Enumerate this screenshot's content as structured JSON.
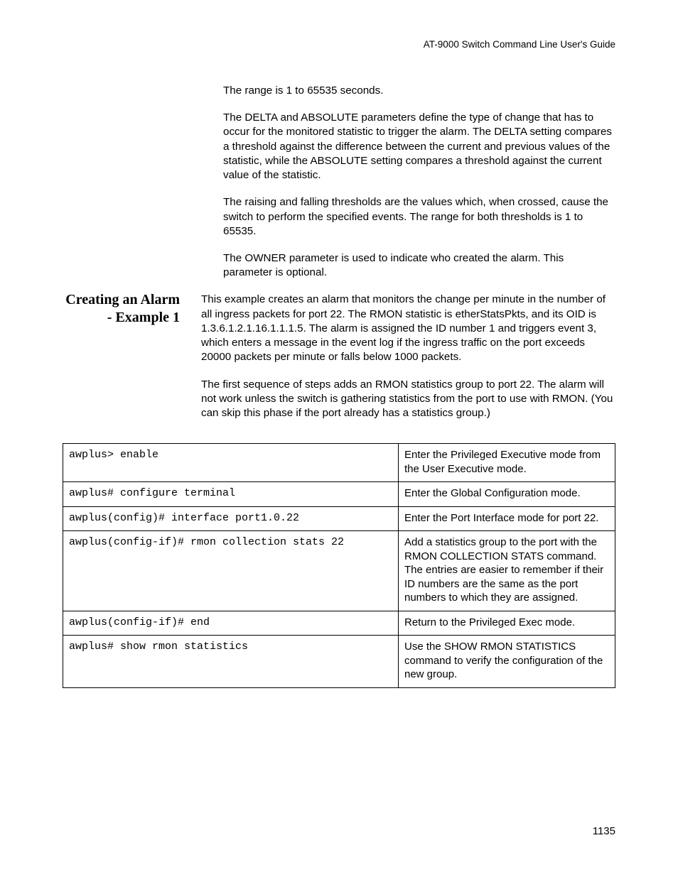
{
  "header": {
    "title": "AT-9000 Switch Command Line User's Guide"
  },
  "intro": {
    "p1": "The range is 1 to 65535 seconds.",
    "p2": "The DELTA and ABSOLUTE parameters define the type of change that has to occur for the monitored statistic to trigger the alarm. The DELTA setting compares a threshold against the difference between the current and previous values of the statistic, while the ABSOLUTE setting compares a threshold against the current value of the statistic.",
    "p3": "The raising and falling thresholds are the values which, when crossed, cause the switch to perform the specified events. The range for both thresholds is 1 to 65535.",
    "p4": "The OWNER parameter is used to indicate who created the alarm. This parameter is optional."
  },
  "section": {
    "heading": "Creating an Alarm - Example 1",
    "p1": "This example creates an alarm that monitors the change per minute in the number of all ingress packets for port 22. The RMON statistic is etherStatsPkts, and its OID is 1.3.6.1.2.1.16.1.1.1.5. The alarm is assigned the ID number 1 and triggers event 3, which enters a message in the event log if the ingress traffic on the port exceeds 20000 packets per minute or falls below 1000 packets.",
    "p2": "The first sequence of steps adds an RMON statistics group to port 22. The alarm will not work unless the switch is gathering statistics from the port to use with RMON. (You can skip this phase if the port already has a statistics group.)"
  },
  "table": {
    "rows": [
      {
        "command": "awplus> enable",
        "description": "Enter the Privileged Executive mode from the User Executive mode."
      },
      {
        "command": "awplus# configure terminal",
        "description": "Enter the Global Configuration mode."
      },
      {
        "command": "awplus(config)# interface port1.0.22",
        "description": "Enter the Port Interface mode for port 22."
      },
      {
        "command": "awplus(config-if)# rmon collection stats 22",
        "description": "Add a statistics group to the port with the RMON COLLECTION STATS command. The entries are easier to remember if their ID numbers are the same as the port numbers to which they are assigned."
      },
      {
        "command": "awplus(config-if)# end",
        "description": "Return to the Privileged Exec mode."
      },
      {
        "command": "awplus# show rmon statistics",
        "description": "Use the SHOW RMON STATISTICS command to verify the configuration of the new group."
      }
    ]
  },
  "footer": {
    "page_number": "1135"
  }
}
